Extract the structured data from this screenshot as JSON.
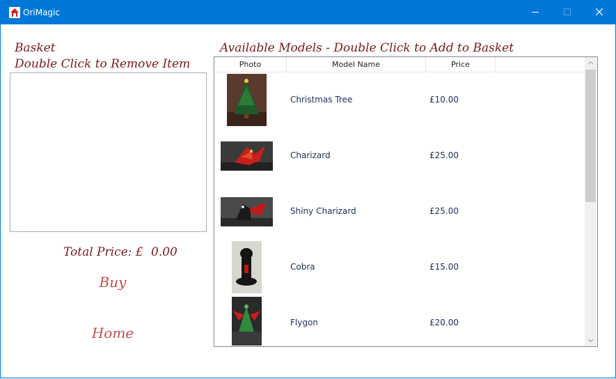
{
  "window": {
    "title": "OriMagic",
    "icon": "house-icon",
    "controls": [
      "minimize-icon",
      "maximize-icon",
      "close-icon"
    ]
  },
  "basket": {
    "title": "Basket",
    "subtitle": "Double Click to Remove Item",
    "items": []
  },
  "total": {
    "label": "Total Price: £",
    "value": "0.00"
  },
  "buttons": {
    "buy": "Buy",
    "home": "Home"
  },
  "models": {
    "title": "Available Models - Double Click to Add to Basket",
    "columns": [
      "Photo",
      "Model Name",
      "Price"
    ],
    "rows": [
      {
        "name": "Christmas Tree",
        "price": "£10.00"
      },
      {
        "name": "Charizard",
        "price": "£25.00"
      },
      {
        "name": "Shiny Charizard",
        "price": "£25.00"
      },
      {
        "name": "Cobra",
        "price": "£15.00"
      },
      {
        "name": "Flygon",
        "price": "£20.00"
      }
    ]
  },
  "colors": {
    "titlebar": "#0078d7",
    "heading_text": "#7a1a1a",
    "button_text": "#c0504d",
    "cell_text": "#1c2e5a"
  }
}
